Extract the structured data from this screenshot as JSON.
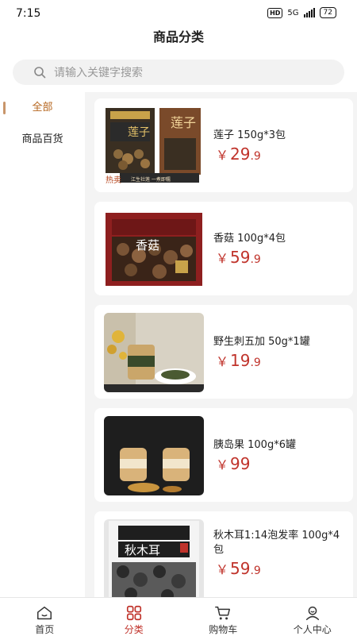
{
  "status_bar": {
    "time": "7:15",
    "hd": "HD",
    "network": "5G",
    "battery": "72"
  },
  "header": {
    "title": "商品分类"
  },
  "search": {
    "placeholder": "请输入关键字搜索"
  },
  "categories": [
    {
      "label": "全部",
      "active": true
    },
    {
      "label": "商品百货",
      "active": false
    }
  ],
  "products": [
    {
      "name": "莲子 150g*3包",
      "price_int": "29",
      "price_dec": ".9",
      "image_text": "莲子",
      "badge": "热卖",
      "image_caption": "江生社莲  一煮即糯"
    },
    {
      "name": "香菇 100g*4包",
      "price_int": "59",
      "price_dec": ".9",
      "image_text": "香菇"
    },
    {
      "name": "野生刺五加 50g*1罐",
      "price_int": "19",
      "price_dec": ".9"
    },
    {
      "name": "胰岛果 100g*6罐",
      "price_int": "99",
      "price_dec": ""
    },
    {
      "name": "秋木耳1:14泡发率 100g*4包",
      "price_int": "59",
      "price_dec": ".9",
      "image_text": "秋木耳"
    }
  ],
  "currency": "￥",
  "tabs": [
    {
      "label": "首页",
      "icon": "home-icon",
      "active": false
    },
    {
      "label": "分类",
      "icon": "category-icon",
      "active": true
    },
    {
      "label": "购物车",
      "icon": "cart-icon",
      "active": false
    },
    {
      "label": "个人中心",
      "icon": "user-icon",
      "active": false
    }
  ],
  "colors": {
    "accent": "#c0332b",
    "category_active": "#b5651d"
  }
}
